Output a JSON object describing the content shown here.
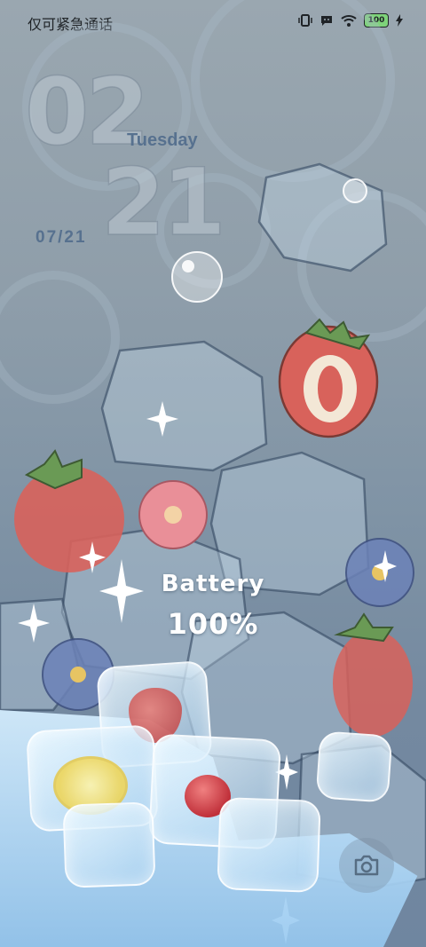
{
  "status_bar": {
    "carrier_text": "仅可紧急通话",
    "icons": [
      "vibrate-icon",
      "message-icon",
      "wifi-icon",
      "battery-icon",
      "charging-icon"
    ],
    "battery_level_percent": 100,
    "battery_label": "100"
  },
  "lockscreen": {
    "clock_hour": "02",
    "clock_minute": "21",
    "weekday": "Tuesday",
    "date": "07/21",
    "battery_title": "Battery",
    "battery_percent": "100%"
  },
  "shortcuts": {
    "camera_icon": "camera-icon"
  },
  "colors": {
    "accent_text": "#57718f",
    "battery_indicator": "#7ed37a"
  }
}
